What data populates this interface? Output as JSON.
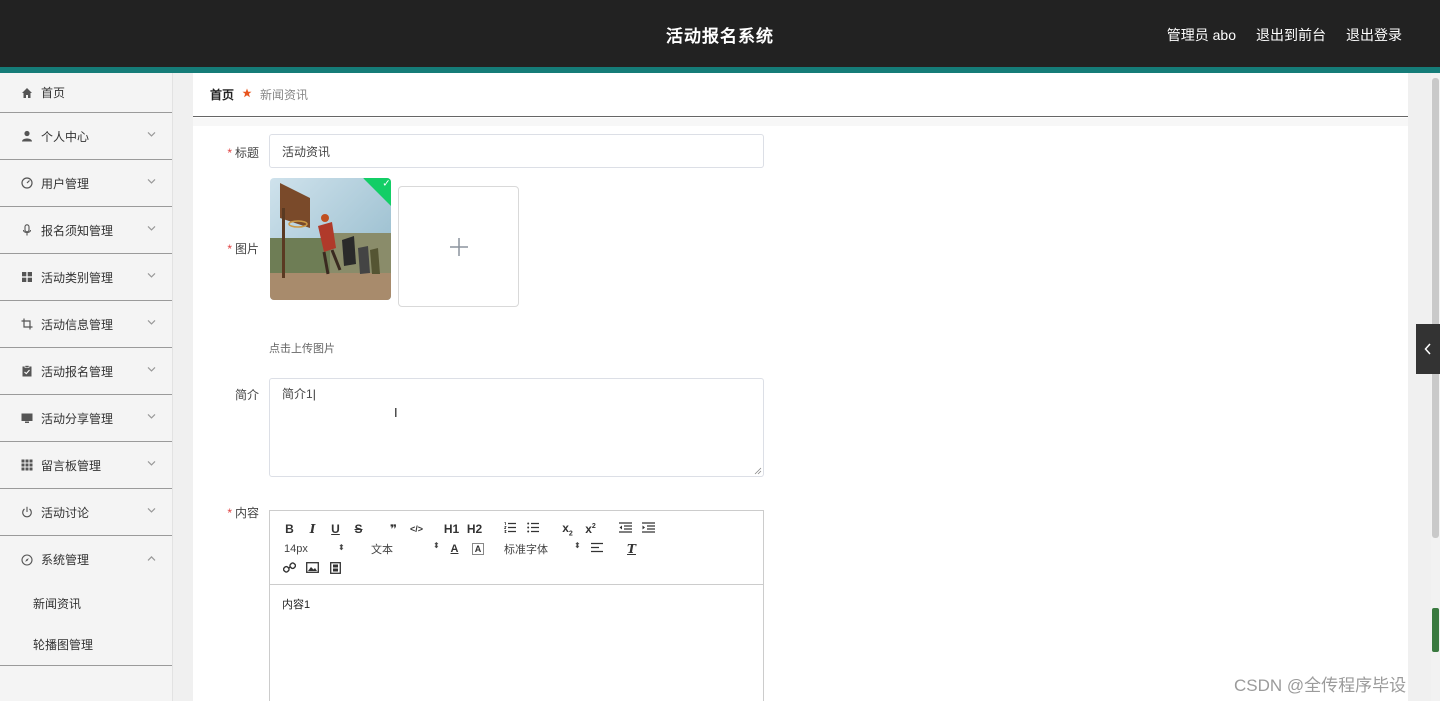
{
  "header": {
    "title": "活动报名系统",
    "user": "管理员 abo",
    "to_front": "退出到前台",
    "logout": "退出登录"
  },
  "sidebar": {
    "items": [
      {
        "label": "首页",
        "icon": "home-icon"
      },
      {
        "label": "个人中心",
        "icon": "user-icon"
      },
      {
        "label": "用户管理",
        "icon": "dashboard-icon"
      },
      {
        "label": "报名须知管理",
        "icon": "microphone-icon"
      },
      {
        "label": "活动类别管理",
        "icon": "grid-icon"
      },
      {
        "label": "活动信息管理",
        "icon": "crop-icon"
      },
      {
        "label": "活动报名管理",
        "icon": "clipboard-icon"
      },
      {
        "label": "活动分享管理",
        "icon": "monitor-icon"
      },
      {
        "label": "留言板管理",
        "icon": "apps-icon"
      },
      {
        "label": "活动讨论",
        "icon": "power-icon"
      },
      {
        "label": "系统管理",
        "icon": "compass-icon"
      }
    ],
    "sub_items": [
      "新闻资讯",
      "轮播图管理"
    ]
  },
  "breadcrumb": {
    "home": "首页",
    "current": "新闻资讯"
  },
  "form": {
    "title_label": "标题",
    "title_value": "活动资讯",
    "image_label": "图片",
    "upload_tip": "点击上传图片",
    "intro_label": "简介",
    "intro_value": "简介1",
    "content_label": "内容",
    "content_value": "内容1"
  },
  "editor": {
    "font_size": "14px",
    "format": "文本",
    "font_family": "标准字体",
    "buttons": [
      "B",
      "I",
      "U",
      "S",
      "❞",
      "</>",
      "H1",
      "H2"
    ]
  },
  "watermark": "CSDN @全传程序毕设",
  "colors": {
    "header_bg": "#222222",
    "accent": "#157c78",
    "required": "#e04040",
    "success": "#13ce66"
  }
}
